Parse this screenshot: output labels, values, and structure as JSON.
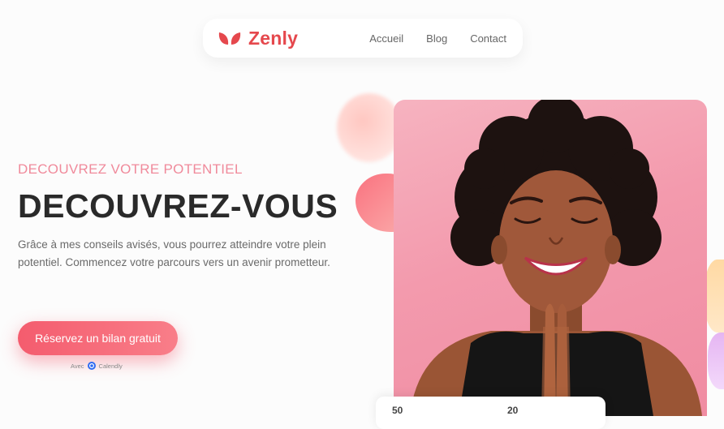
{
  "nav": {
    "brand": "Zenly",
    "links": [
      "Accueil",
      "Blog",
      "Contact"
    ]
  },
  "hero": {
    "eyebrow": "DECOUVREZ VOTRE POTENTIEL",
    "headline": "DECOUVREZ-VOUS",
    "description": "Grâce à mes conseils avisés, vous pourrez atteindre votre plein potentiel. Commencez votre parcours vers un avenir prometteur.",
    "cta_label": "Réservez un bilan gratuit",
    "calendly_prefix": "Avec",
    "calendly_name": "Calendly",
    "image_icon": "woman-praying-photo"
  },
  "card": {
    "stat_1": "50",
    "stat_2": "20"
  },
  "colors": {
    "brand": "#e5484d",
    "accent": "#f45c6e",
    "eyebrow": "#f08a9b",
    "photo_background": "#f39aad"
  }
}
